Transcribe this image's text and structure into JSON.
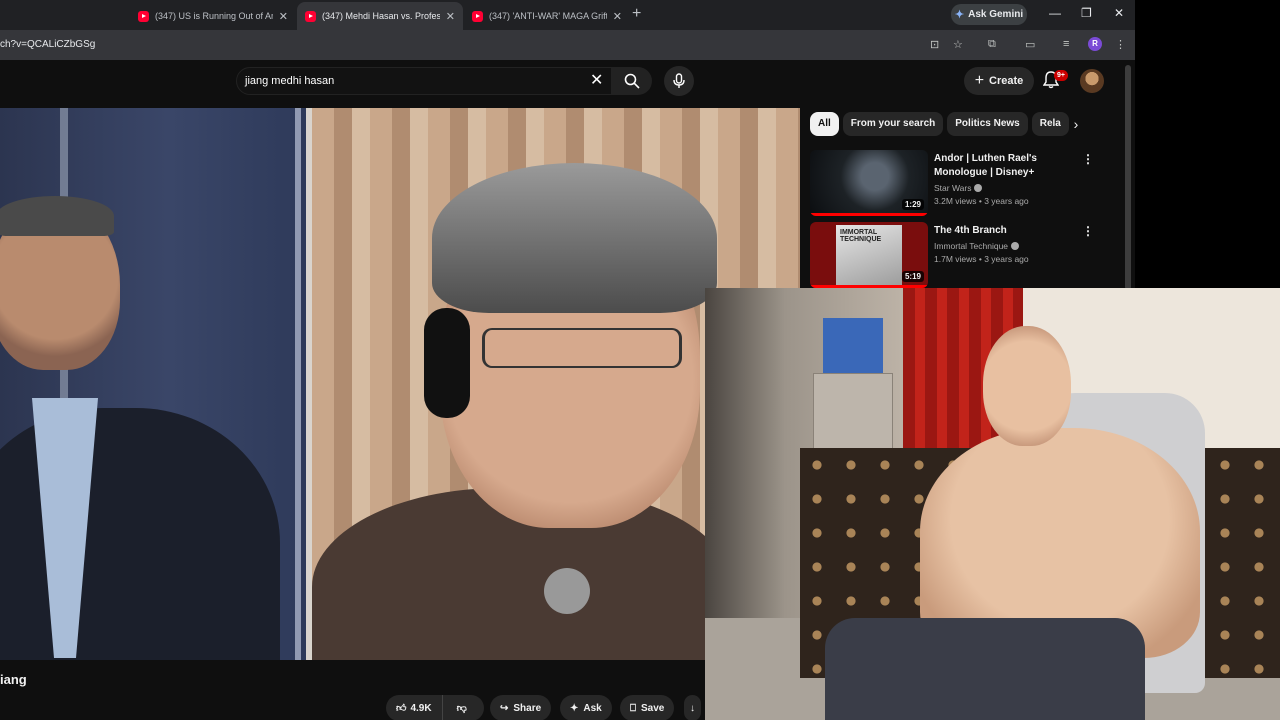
{
  "browser": {
    "tabs": [
      {
        "title": "(347) US is Running Out of Am",
        "active": false
      },
      {
        "title": "(347) Mehdi Hasan vs. Professo",
        "active": true
      },
      {
        "title": "(347) 'ANTI-WAR' MAGA Grifte",
        "active": false
      }
    ],
    "ask_gemini": "Ask Gemini",
    "url": "ch?v=QCALiCZbGSg",
    "profile_initial": "R"
  },
  "youtube": {
    "search_query": "jiang medhi hasan",
    "create_label": "Create",
    "notification_badge": "9+",
    "video": {
      "title_fragment": "iang",
      "likes": "4.9K",
      "share_label": "Share",
      "ask_label": "Ask",
      "save_label": "Save"
    },
    "chips": [
      "All",
      "From your search",
      "Politics News",
      "Rela"
    ],
    "recommendations": [
      {
        "title": "Andor | Luthen Rael's Monologue | Disney+",
        "channel": "Star Wars",
        "meta": "3.2M views • 3 years ago",
        "duration": "1:29",
        "watched_fraction": 1.0
      },
      {
        "title": "The 4th Branch",
        "channel": "Immortal Technique",
        "meta": "1.7M views • 3 years ago",
        "duration": "5:19",
        "watched_fraction": 1.0,
        "thumbnail_text": "IMMORTAL TECHNIQUE"
      }
    ]
  },
  "colors": {
    "brand": "#ff0000",
    "chrome_bg": "#202124",
    "page_bg": "#0f0f0f"
  }
}
